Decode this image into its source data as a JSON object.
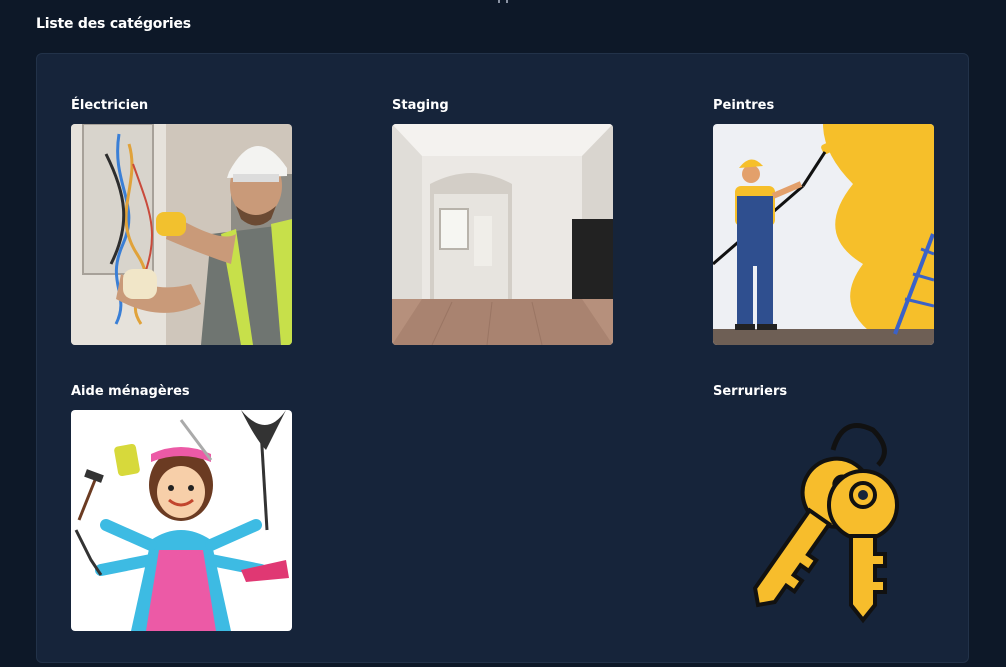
{
  "page": {
    "title": "Liste des catégories"
  },
  "categories": [
    {
      "label": "Électricien",
      "image": "electrician-photo"
    },
    {
      "label": "Staging",
      "image": "empty-room-photo"
    },
    {
      "label": "Peintres",
      "image": "painter-illustration"
    },
    {
      "label": "Aide ménagères",
      "image": "housekeeper-illustration"
    },
    {
      "label": "Serruriers",
      "image": "keys-icon"
    }
  ]
}
